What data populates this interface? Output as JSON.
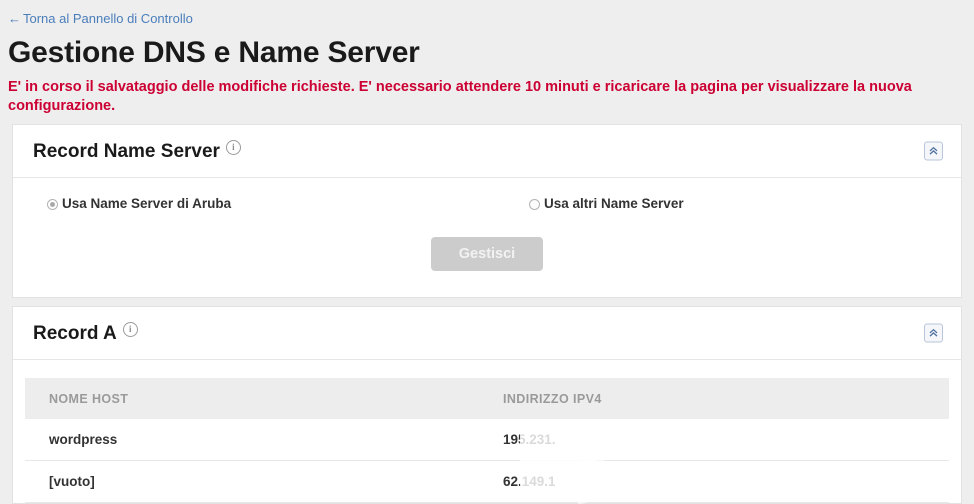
{
  "header": {
    "back_link": "Torna al Pannello di Controllo",
    "back_arrow": "←",
    "title": "Gestione DNS e Name Server",
    "alert": "E' in corso il salvataggio delle modifiche richieste. E' necessario attendere 10 minuti e ricaricare la pagina per visualizzare la nuova configurazione.",
    "alert_color": "#cc0033"
  },
  "panels": {
    "name_server": {
      "title": "Record Name Server",
      "info_glyph": "i",
      "collapse_icon": "double-chevron-up",
      "options": [
        {
          "label": "Usa Name Server di Aruba",
          "selected": true
        },
        {
          "label": "Usa altri Name Server",
          "selected": false
        }
      ],
      "manage_button": {
        "label": "Gestisci",
        "disabled": true
      }
    },
    "record_a": {
      "title": "Record A",
      "info_glyph": "i",
      "collapse_icon": "double-chevron-up",
      "table": {
        "columns": [
          "NOME HOST",
          "INDIRIZZO IPV4"
        ],
        "rows": [
          {
            "host": "wordpress",
            "ipv4": "195.231."
          },
          {
            "host": "[vuoto]",
            "ipv4": "62.149.1"
          }
        ]
      }
    }
  }
}
